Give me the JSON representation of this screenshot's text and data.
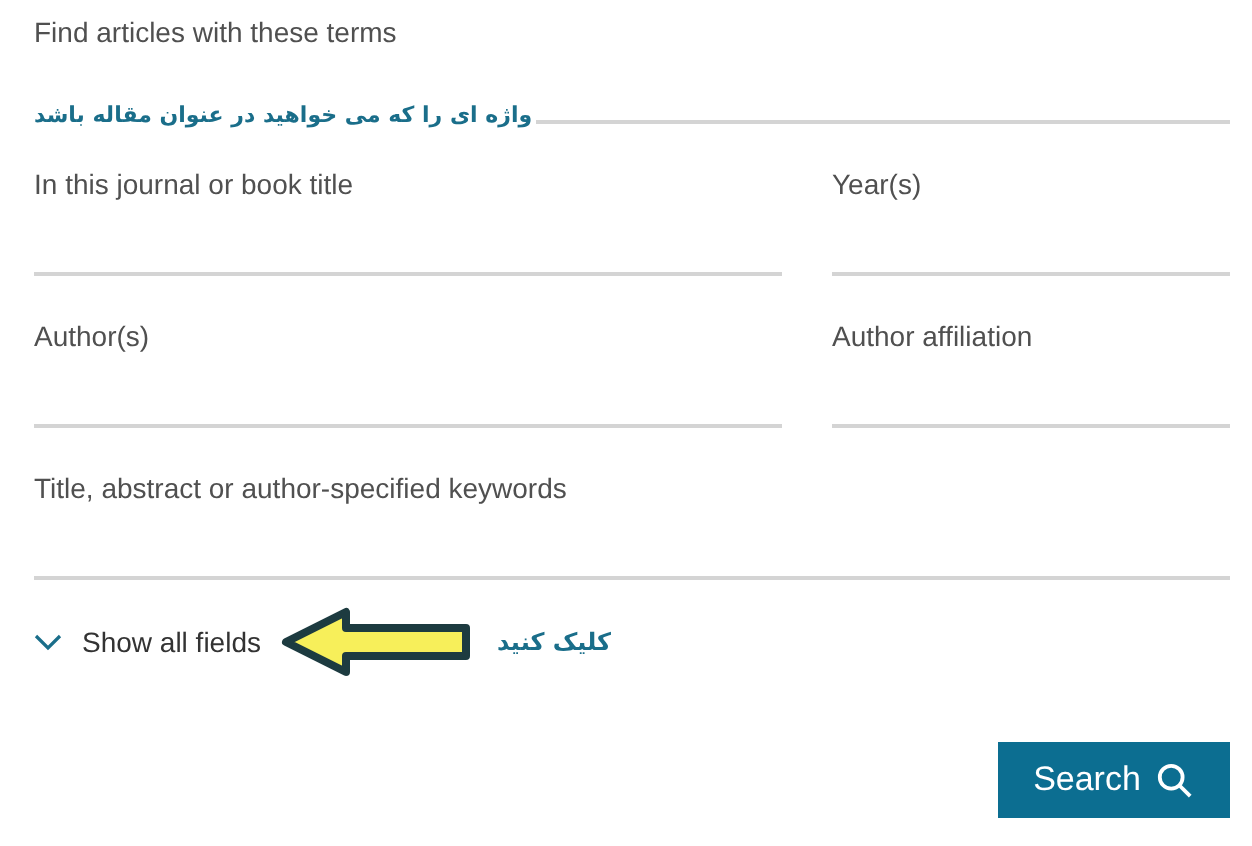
{
  "rows": [
    [
      {
        "label": "Find articles with these terms",
        "kind": "full",
        "note": "واژه ای را که می خواهید در عنوان مقاله باشد"
      }
    ],
    [
      {
        "label": "In this journal or book title",
        "kind": "wide"
      },
      {
        "label": "Year(s)",
        "kind": "narrow"
      }
    ],
    [
      {
        "label": "Author(s)",
        "kind": "wide"
      },
      {
        "label": "Author affiliation",
        "kind": "narrow"
      }
    ],
    [
      {
        "label": "Title, abstract or author-specified keywords",
        "kind": "full"
      }
    ]
  ],
  "show_all": {
    "label": "Show all fields",
    "expanded": false,
    "note": "کلیک کنید"
  },
  "search_button": {
    "label": "Search"
  }
}
